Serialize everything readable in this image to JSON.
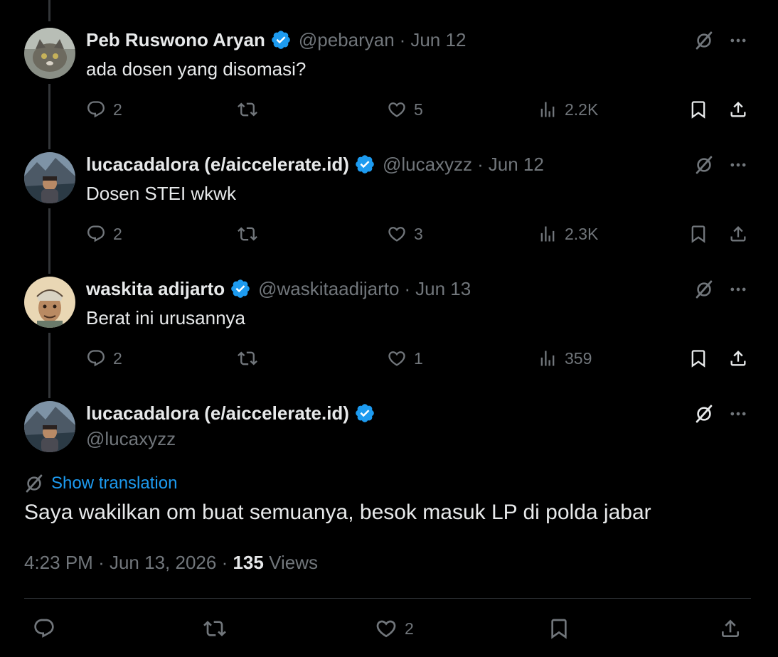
{
  "tweets": [
    {
      "name": "Peb Ruswono Aryan",
      "handle": "@pebaryan",
      "separator": "·",
      "date": "Jun 12",
      "text": "ada dosen yang disomasi?",
      "replies": "2",
      "likes": "5",
      "views": "2.2K"
    },
    {
      "name": "lucacadalora (e/aiccelerate.id)",
      "handle": "@lucaxyzz",
      "separator": "·",
      "date": "Jun 12",
      "text": "Dosen STEI wkwk",
      "replies": "2",
      "likes": "3",
      "views": "2.3K"
    },
    {
      "name": "waskita adijarto",
      "handle": "@waskitaadijarto",
      "separator": "·",
      "date": "Jun 13",
      "text": "Berat ini urusannya",
      "replies": "2",
      "likes": "1",
      "views": "359"
    }
  ],
  "main_tweet": {
    "name": "lucacadalora (e/aiccelerate.id)",
    "handle": "@lucaxyzz",
    "show_translation": "Show translation",
    "text": "Saya wakilkan om buat semuanya, besok masuk LP di polda jabar",
    "time": "4:23 PM",
    "sep1": "·",
    "full_date": "Jun 13, 2026",
    "sep2": "·",
    "views_count": "135",
    "views_label": "Views",
    "likes": "2"
  },
  "icons": {
    "grok": "grok-icon",
    "more": "more-icon",
    "reply": "reply-icon",
    "retweet": "retweet-icon",
    "like": "heart-icon",
    "views": "views-icon",
    "bookmark": "bookmark-icon",
    "share": "share-icon",
    "verified": "verified-badge-icon"
  },
  "colors": {
    "background": "#000000",
    "text": "#e7e9ea",
    "muted": "#71767b",
    "accent": "#1d9bf0",
    "verified": "#1d9bf0"
  }
}
